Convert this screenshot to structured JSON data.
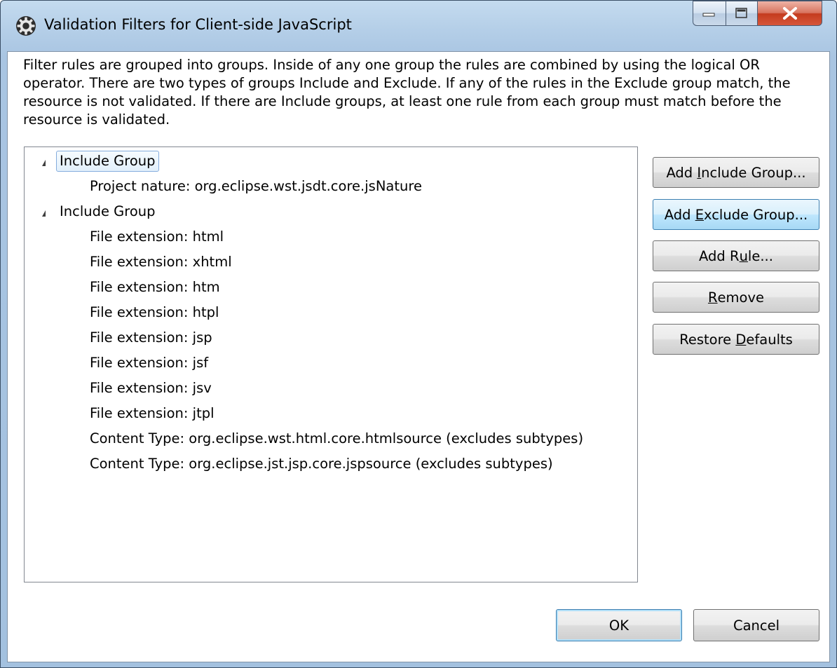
{
  "window": {
    "title": "Validation Filters for Client-side JavaScript"
  },
  "description": "Filter rules are grouped into groups. Inside of any one group the rules are combined by using the logical OR operator. There are two types of groups Include and Exclude. If any of the rules in the Exclude group match, the resource is not validated. If there are Include groups, at least one rule from each group must match before the resource is validated.",
  "tree": {
    "groups": [
      {
        "label": "Include Group",
        "selected": true,
        "rules": [
          "Project nature: org.eclipse.wst.jsdt.core.jsNature"
        ]
      },
      {
        "label": "Include Group",
        "selected": false,
        "rules": [
          "File extension: html",
          "File extension: xhtml",
          "File extension: htm",
          "File extension: htpl",
          "File extension: jsp",
          "File extension: jsf",
          "File extension: jsv",
          "File extension: jtpl",
          "Content Type: org.eclipse.wst.html.core.htmlsource (excludes subtypes)",
          "Content Type: org.eclipse.jst.jsp.core.jspsource (excludes subtypes)"
        ]
      }
    ]
  },
  "buttons": {
    "add_include": {
      "pre": "Add ",
      "mnemonic": "I",
      "post": "nclude Group..."
    },
    "add_exclude": {
      "pre": "Add ",
      "mnemonic": "E",
      "post": "xclude Group..."
    },
    "add_rule": {
      "pre": "Add R",
      "mnemonic": "u",
      "post": "le..."
    },
    "remove": {
      "pre": "",
      "mnemonic": "R",
      "post": "emove"
    },
    "restore": {
      "pre": "Restore ",
      "mnemonic": "D",
      "post": "efaults"
    },
    "ok": "OK",
    "cancel": "Cancel"
  }
}
